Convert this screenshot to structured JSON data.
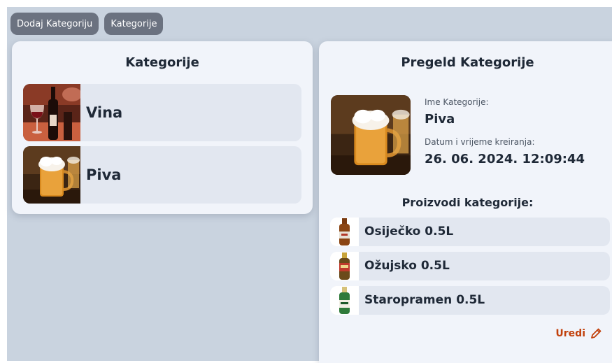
{
  "toolbar": {
    "add_category_label": "Dodaj Kategoriju",
    "categories_label": "Kategorije"
  },
  "left_panel": {
    "title": "Kategorije",
    "items": [
      {
        "label": "Vina",
        "image": "wine-photo"
      },
      {
        "label": "Piva",
        "image": "beer-photo"
      }
    ]
  },
  "right_panel": {
    "title": "Pregeld Kategorije",
    "image": "beer-photo",
    "name_label": "Ime Kategorije:",
    "name_value": "Piva",
    "date_label": "Datum i vrijeme kreiranja:",
    "date_value": "26. 06. 2024. 12:09:44",
    "products_title": "Proizvodi kategorije:",
    "products": [
      {
        "label": "Osiječko 0.5L",
        "image": "bottle-osijecko"
      },
      {
        "label": "Ožujsko 0.5L",
        "image": "bottle-ozujsko"
      },
      {
        "label": "Staropramen 0.5L",
        "image": "bottle-staropramen"
      }
    ],
    "edit_label": "Uredi",
    "edit_icon": "pencil-icon"
  },
  "colors": {
    "background": "#c9d3df",
    "panel": "#f1f4fa",
    "item": "#e2e7f0",
    "button": "#6b7280",
    "accent": "#c2410c"
  }
}
